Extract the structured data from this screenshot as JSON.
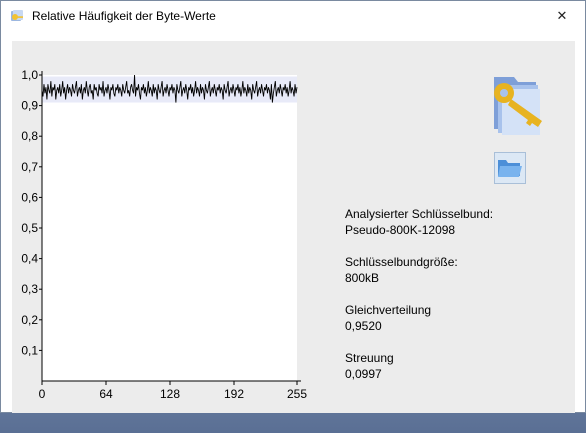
{
  "window": {
    "title": "Relative Häufigkeit der Byte-Werte",
    "close_glyph": "✕"
  },
  "chart_data": {
    "type": "line",
    "title": "",
    "xlabel": "",
    "ylabel": "",
    "xlim": [
      0,
      255
    ],
    "ylim": [
      0,
      1.0
    ],
    "x_ticks": [
      "0",
      "64",
      "128",
      "192",
      "255"
    ],
    "y_ticks": [
      "0,1",
      "0,2",
      "0,3",
      "0,4",
      "0,5",
      "0,6",
      "0,7",
      "0,8",
      "0,9",
      "1,0"
    ],
    "mean": 0.952,
    "band": [
      0.91,
      0.995
    ],
    "series_color": "#000000",
    "band_color": "#e8eaf8",
    "values": [
      0.95,
      0.93,
      0.97,
      0.94,
      0.96,
      0.92,
      0.97,
      0.95,
      0.94,
      0.98,
      0.93,
      0.96,
      0.95,
      0.97,
      0.92,
      0.95,
      0.96,
      0.94,
      0.97,
      0.93,
      0.95,
      0.98,
      0.94,
      0.96,
      0.92,
      0.95,
      0.97,
      0.94,
      0.96,
      0.95,
      0.93,
      0.97,
      0.95,
      0.94,
      0.96,
      0.98,
      0.93,
      0.95,
      0.96,
      0.94,
      0.97,
      0.92,
      0.95,
      0.96,
      0.94,
      0.98,
      0.95,
      0.93,
      0.96,
      0.97,
      0.94,
      0.95,
      0.92,
      0.97,
      0.95,
      0.96,
      0.94,
      0.93,
      0.97,
      0.95,
      0.96,
      0.94,
      0.98,
      0.93,
      0.95,
      0.96,
      0.94,
      0.97,
      0.95,
      0.92,
      0.96,
      0.95,
      0.97,
      0.94,
      0.93,
      0.96,
      0.95,
      0.97,
      0.94,
      0.96,
      0.95,
      0.93,
      0.97,
      0.95,
      0.94,
      0.96,
      0.98,
      0.94,
      0.95,
      0.93,
      0.96,
      0.97,
      0.95,
      0.94,
      1.0,
      0.93,
      0.96,
      0.95,
      0.97,
      0.94,
      0.92,
      0.96,
      0.95,
      0.97,
      0.94,
      0.96,
      0.93,
      0.95,
      0.98,
      0.94,
      0.96,
      0.95,
      0.93,
      0.97,
      0.94,
      0.96,
      0.95,
      0.92,
      0.97,
      0.95,
      0.94,
      0.96,
      0.98,
      0.93,
      0.95,
      0.96,
      0.94,
      0.97,
      0.95,
      0.93,
      0.96,
      0.95,
      0.97,
      0.94,
      0.96,
      0.95,
      0.91,
      0.97,
      0.95,
      0.94,
      0.96,
      0.98,
      0.93,
      0.95,
      0.96,
      0.94,
      0.97,
      0.95,
      0.92,
      0.96,
      0.95,
      0.97,
      0.94,
      0.96,
      0.93,
      0.95,
      0.98,
      0.94,
      0.96,
      0.95,
      0.93,
      0.97,
      0.94,
      0.96,
      0.95,
      0.92,
      0.97,
      0.95,
      0.94,
      0.96,
      0.98,
      0.93,
      0.95,
      0.96,
      0.94,
      0.97,
      0.95,
      0.93,
      0.96,
      0.95,
      0.97,
      0.94,
      0.96,
      0.95,
      0.92,
      0.97,
      0.95,
      0.94,
      0.96,
      0.98,
      0.93,
      0.95,
      0.96,
      0.94,
      0.97,
      0.95,
      0.93,
      0.96,
      0.95,
      0.97,
      0.94,
      0.96,
      0.93,
      0.95,
      0.98,
      0.94,
      0.96,
      0.95,
      0.93,
      0.97,
      0.94,
      0.96,
      0.95,
      0.92,
      0.97,
      0.95,
      0.94,
      0.96,
      0.98,
      0.93,
      0.95,
      0.96,
      0.94,
      0.97,
      0.95,
      0.93,
      0.96,
      0.95,
      0.97,
      0.94,
      0.96,
      0.95,
      0.92,
      0.97,
      0.91,
      0.94,
      0.96,
      0.98,
      0.93,
      0.95,
      0.96,
      0.94,
      0.97,
      0.95,
      0.93,
      0.96,
      0.95,
      0.97,
      0.94,
      0.96,
      0.93,
      0.95,
      0.98,
      0.94,
      0.96,
      0.95,
      0.93,
      0.97,
      0.94,
      0.96
    ]
  },
  "info": {
    "keyring_label": "Analysierter Schlüsselbund:",
    "keyring_value": "Pseudo-800K-12098",
    "size_label": "Schlüsselbundgröße:",
    "size_value": "800kB",
    "uniformity_label": "Gleichverteilung",
    "uniformity_value": "0,9520",
    "deviation_label": "Streuung",
    "deviation_value": "0,0997"
  },
  "icons": {
    "title_icon": "keyring-app-icon",
    "key_icon": "key-folder-icon",
    "open_icon": "open-folder-icon"
  }
}
